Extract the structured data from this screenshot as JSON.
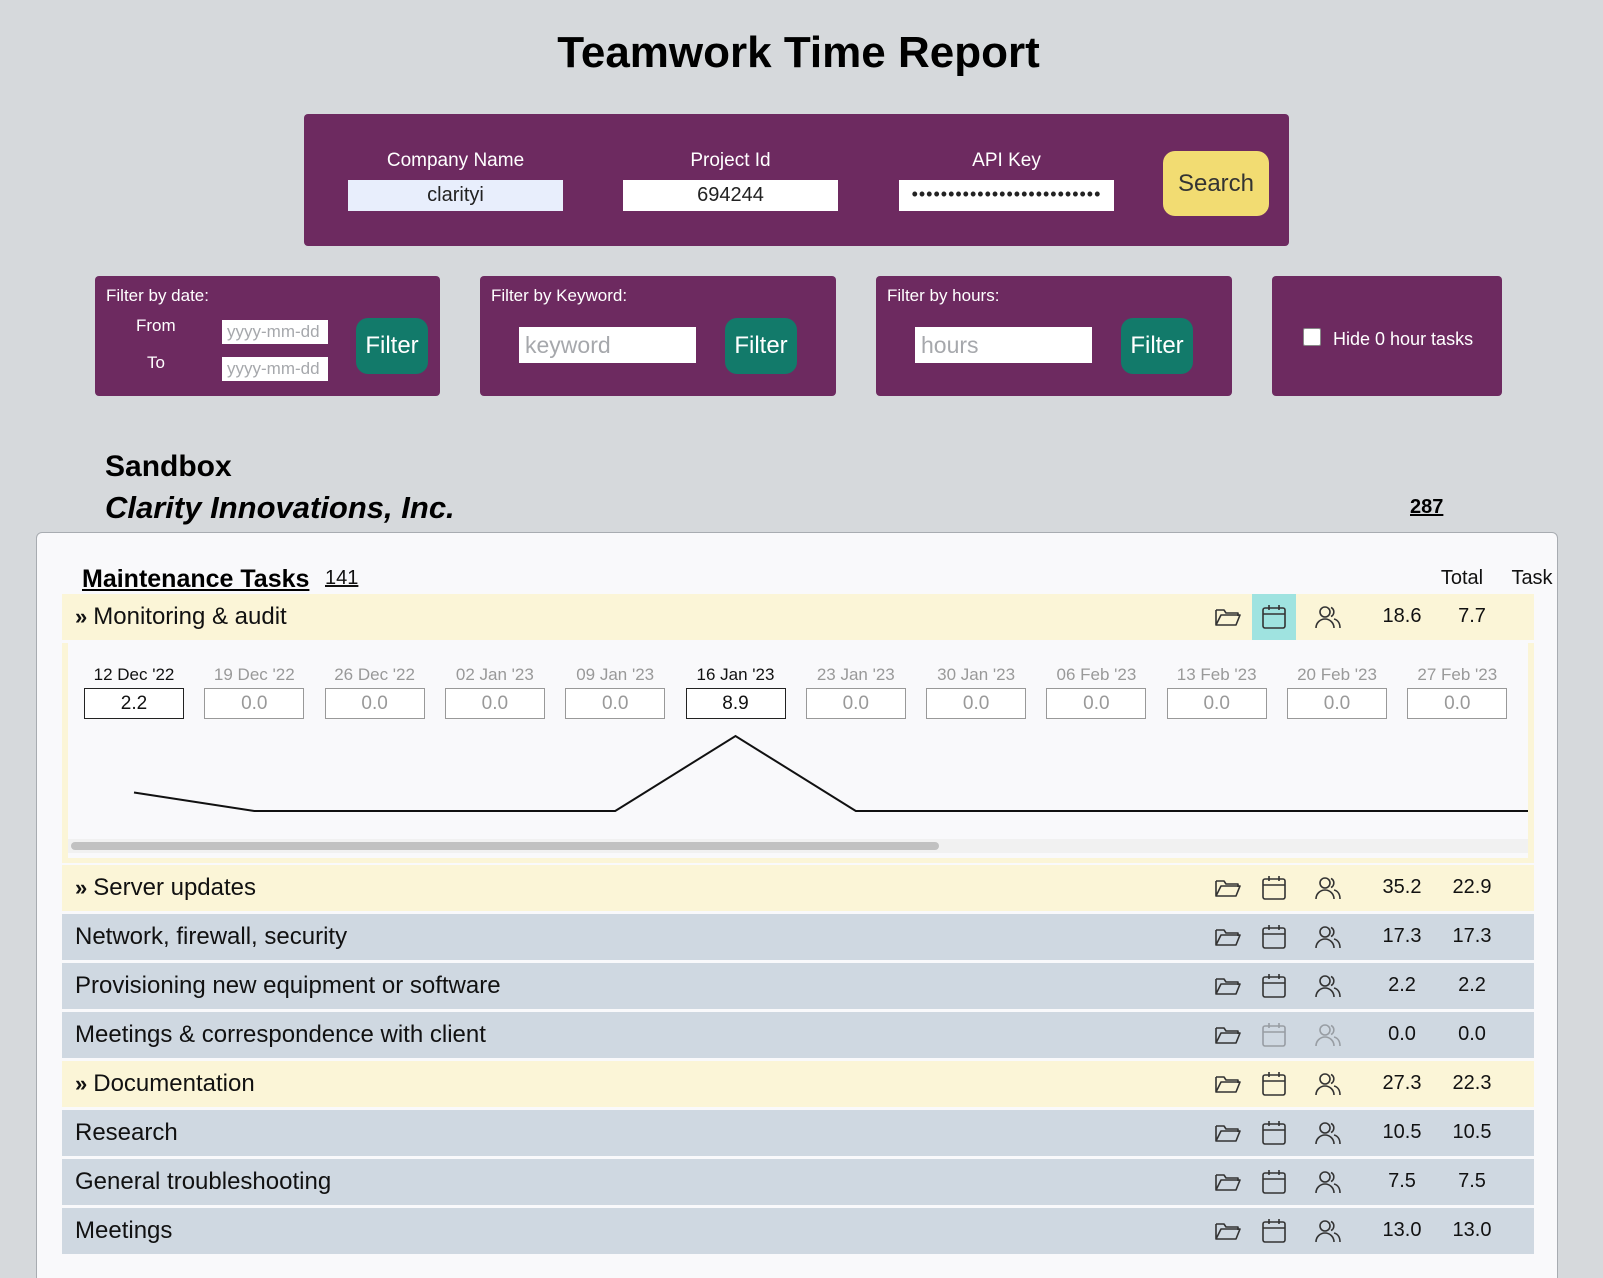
{
  "title": "Teamwork Time Report",
  "search": {
    "company_label": "Company Name",
    "company_value": "clarityi",
    "project_label": "Project Id",
    "project_value": "694244",
    "api_label": "API Key",
    "api_value": "••••••••••••••••••••••••••",
    "search_label": "Search"
  },
  "filters": {
    "date": {
      "title": "Filter by date:",
      "from_label": "From",
      "to_label": "To",
      "from_placeholder": "yyyy-mm-dd",
      "to_placeholder": "yyyy-mm-dd",
      "button": "Filter"
    },
    "keyword": {
      "title": "Filter by Keyword:",
      "placeholder": "keyword",
      "button": "Filter"
    },
    "hours": {
      "title": "Filter by hours:",
      "placeholder": "hours",
      "button": "Filter"
    },
    "hide_zero": {
      "label": "Hide 0 hour tasks",
      "checked": false
    }
  },
  "project": {
    "name": "Sandbox",
    "company": "Clarity Innovations, Inc.",
    "total": "287"
  },
  "section": {
    "title": "Maintenance Tasks",
    "count": "141",
    "col_total": "Total",
    "col_task": "Task"
  },
  "weekly": {
    "weeks": [
      {
        "date": "12 Dec '22",
        "value": "2.2",
        "active": true
      },
      {
        "date": "19 Dec '22",
        "value": "0.0",
        "active": false
      },
      {
        "date": "26 Dec '22",
        "value": "0.0",
        "active": false
      },
      {
        "date": "02 Jan '23",
        "value": "0.0",
        "active": false
      },
      {
        "date": "09 Jan '23",
        "value": "0.0",
        "active": false
      },
      {
        "date": "16 Jan '23",
        "value": "8.9",
        "active": true
      },
      {
        "date": "23 Jan '23",
        "value": "0.0",
        "active": false
      },
      {
        "date": "30 Jan '23",
        "value": "0.0",
        "active": false
      },
      {
        "date": "06 Feb '23",
        "value": "0.0",
        "active": false
      },
      {
        "date": "13 Feb '23",
        "value": "0.0",
        "active": false
      },
      {
        "date": "20 Feb '23",
        "value": "0.0",
        "active": false
      },
      {
        "date": "27 Feb '23",
        "value": "0.0",
        "active": false
      }
    ]
  },
  "tasks": [
    {
      "label": "Monitoring & audit",
      "expandable": true,
      "color": "yellow",
      "total": "18.6",
      "task": "7.7",
      "calendar_active": true
    },
    {
      "label": "Server updates",
      "expandable": true,
      "color": "yellow",
      "total": "35.2",
      "task": "22.9"
    },
    {
      "label": "Network, firewall, security",
      "expandable": false,
      "color": "gray",
      "total": "17.3",
      "task": "17.3"
    },
    {
      "label": "Provisioning new equipment or software",
      "expandable": false,
      "color": "gray",
      "total": "2.2",
      "task": "2.2"
    },
    {
      "label": "Meetings & correspondence with client",
      "expandable": false,
      "color": "gray",
      "total": "0.0",
      "task": "0.0",
      "dim": true
    },
    {
      "label": "Documentation",
      "expandable": true,
      "color": "yellow",
      "total": "27.3",
      "task": "22.3"
    },
    {
      "label": "Research",
      "expandable": false,
      "color": "gray",
      "total": "10.5",
      "task": "10.5"
    },
    {
      "label": "General troubleshooting",
      "expandable": false,
      "color": "gray",
      "total": "7.5",
      "task": "7.5"
    },
    {
      "label": "Meetings",
      "expandable": false,
      "color": "gray",
      "total": "13.0",
      "task": "13.0"
    }
  ],
  "icons": [
    "folder-icon",
    "calendar-icon",
    "people-icon",
    "chevron-double-right-icon"
  ],
  "colors": {
    "panel": "#6d2a60",
    "search_button": "#f2dc72",
    "filter_button": "#127a6a",
    "row_yellow": "#fbf5d7",
    "row_gray": "#cfd8e1",
    "calendar_highlight": "#9fe3e0"
  }
}
